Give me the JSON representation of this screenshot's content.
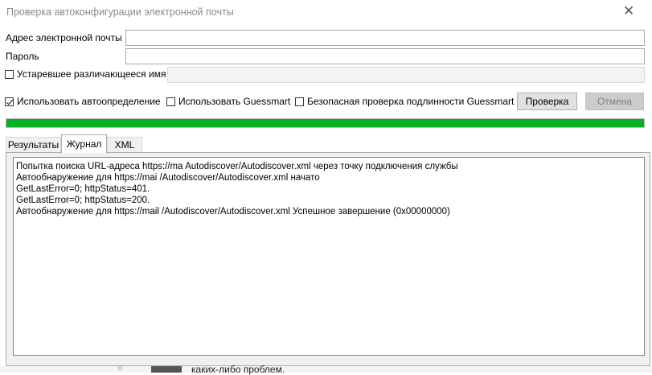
{
  "window": {
    "title": "Проверка автоконфигурации электронной почты",
    "close_glyph": "✕"
  },
  "form": {
    "email_label": "Адрес электронной почты",
    "email_value": "",
    "password_label": "Пароль",
    "password_value": "",
    "legacy_label": "Устаревшее различающееся имя",
    "legacy_checked": false
  },
  "options": {
    "autodetect_label": "Использовать автоопределение",
    "autodetect_checked": true,
    "guessmart_label": "Использовать Guessmart",
    "guessmart_checked": false,
    "secure_guessmart_label": "Безопасная проверка подлинности Guessmart",
    "secure_guessmart_checked": false
  },
  "buttons": {
    "test_label": "Проверка",
    "cancel_label": "Отмена"
  },
  "progress": {
    "percent": 100,
    "color": "#06b025"
  },
  "tabs": [
    {
      "label": "Результаты",
      "active": false
    },
    {
      "label": "Журнал",
      "active": true
    },
    {
      "label": "XML",
      "active": false
    }
  ],
  "log": [
    "Попытка поиска URL-адреса https://ma                          Autodiscover/Autodiscover.xml через точку подключения службы",
    "Автообнаружение для https://mai                          /Autodiscover/Autodiscover.xml начато",
    "GetLastError=0; httpStatus=401.",
    "GetLastError=0; httpStatus=200.",
    "Автообнаружение для https://mail                          /Autodiscover/Autodiscover.xml Успешное завершение (0x00000000)"
  ],
  "background": {
    "partial_text": "каких-либо проблем."
  }
}
